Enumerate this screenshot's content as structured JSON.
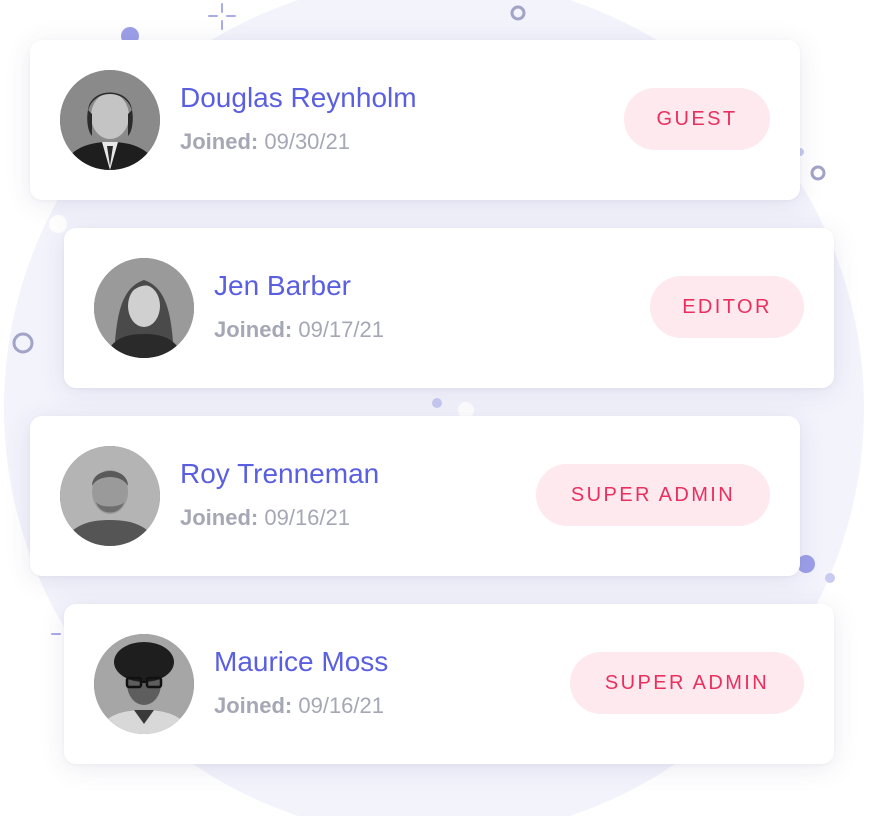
{
  "users": [
    {
      "name": "Douglas Reynholm",
      "joined_label": "Joined:",
      "joined_date": "09/30/21",
      "role": "GUEST"
    },
    {
      "name": "Jen Barber",
      "joined_label": "Joined:",
      "joined_date": "09/17/21",
      "role": "EDITOR"
    },
    {
      "name": "Roy Trenneman",
      "joined_label": "Joined:",
      "joined_date": "09/16/21",
      "role": "SUPER ADMIN"
    },
    {
      "name": "Maurice Moss",
      "joined_label": "Joined:",
      "joined_date": "09/16/21",
      "role": "SUPER ADMIN"
    }
  ],
  "colors": {
    "name": "#5a5fe0",
    "joined": "#a5a7b4",
    "badge_bg": "#fde9ee",
    "badge_text": "#ea2f5f",
    "background_blob": "#f3f3fc",
    "decor": "#9c9fe8"
  }
}
